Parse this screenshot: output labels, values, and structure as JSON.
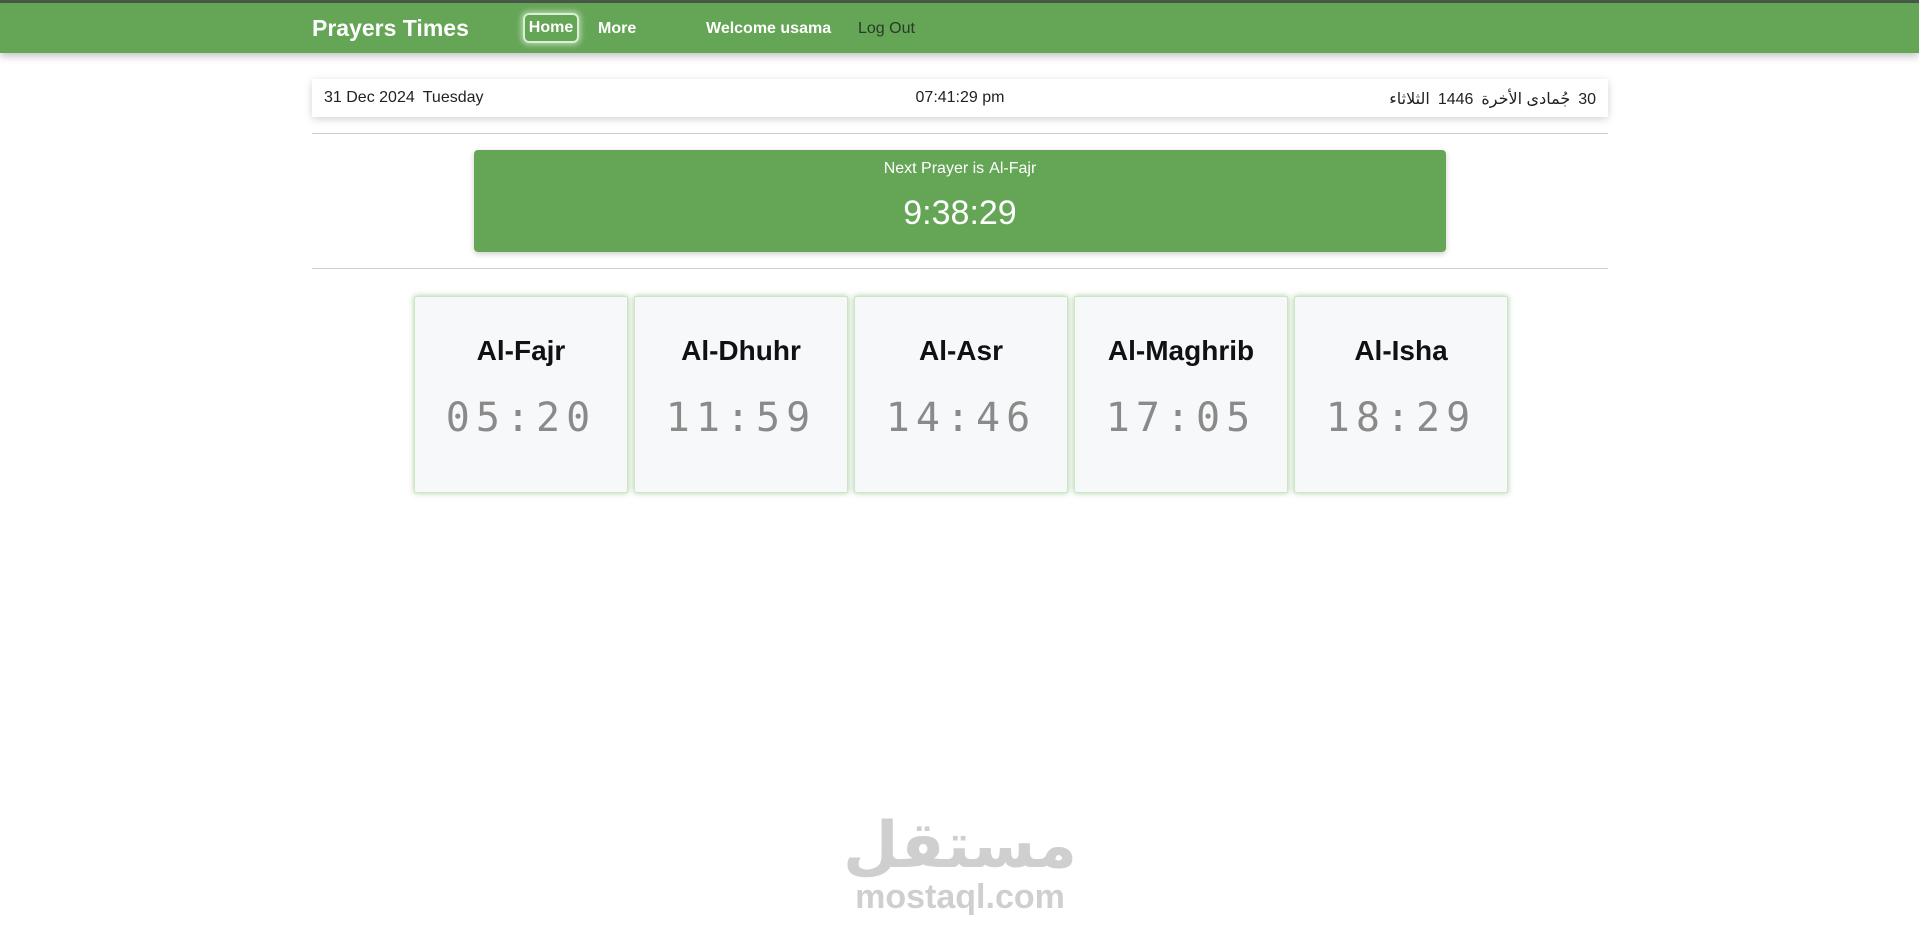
{
  "navbar": {
    "brand": "Prayers Times",
    "home_label": "Home",
    "more_label": "More",
    "welcome": "Welcome usama",
    "logout_label": "Log Out"
  },
  "datebar": {
    "date": "31 Dec 2024",
    "weekday": "Tuesday",
    "time": "07:41:29 pm",
    "hijri_day": "30",
    "hijri_month": "جُمادى الأخرة",
    "hijri_year": "1446",
    "hijri_weekday": "الثلاثاء"
  },
  "next_prayer": {
    "label": "Next Prayer is",
    "name": "Al-Fajr",
    "countdown": "9:38:29"
  },
  "prayers": [
    {
      "name": "Al-Fajr",
      "time": "05:20"
    },
    {
      "name": "Al-Dhuhr",
      "time": "11:59"
    },
    {
      "name": "Al-Asr",
      "time": "14:46"
    },
    {
      "name": "Al-Maghrib",
      "time": "17:05"
    },
    {
      "name": "Al-Isha",
      "time": "18:29"
    }
  ],
  "watermark": {
    "arabic": "مستقل",
    "latin": "mostaql.com"
  },
  "colors": {
    "primary_green": "#64a556",
    "card_bg": "#f7f8fa"
  }
}
